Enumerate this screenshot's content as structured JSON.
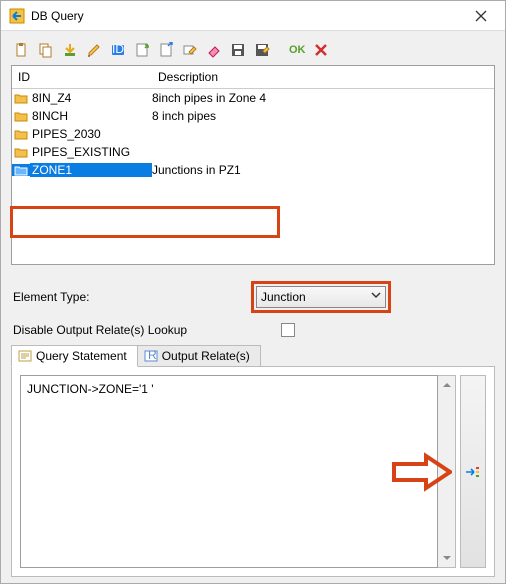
{
  "window": {
    "title": "DB Query"
  },
  "toolbar": {
    "icons": [
      "paste",
      "copy",
      "import",
      "edit-pencil",
      "id-badge",
      "new",
      "open",
      "rename",
      "erase",
      "save",
      "save-as",
      "ok",
      "cancel"
    ],
    "ok_label": "OK"
  },
  "list": {
    "headers": {
      "id": "ID",
      "description": "Description"
    },
    "rows": [
      {
        "id": "8IN_Z4",
        "desc": "8inch pipes in Zone 4",
        "selected": false
      },
      {
        "id": "8INCH",
        "desc": "8 inch pipes",
        "selected": false
      },
      {
        "id": "PIPES_2030",
        "desc": "",
        "selected": false
      },
      {
        "id": "PIPES_EXISTING",
        "desc": "",
        "selected": false
      },
      {
        "id": "ZONE1",
        "desc": "Junctions in PZ1",
        "selected": true
      }
    ]
  },
  "element_type": {
    "label": "Element Type:",
    "value": "Junction"
  },
  "disable_lookup": {
    "label": "Disable Output Relate(s) Lookup",
    "checked": false
  },
  "tabs": {
    "query": "Query Statement",
    "relates": "Output Relate(s)",
    "active": "query"
  },
  "query": {
    "text": "JUNCTION->ZONE='1 '"
  },
  "narrow_icon": "narrow-icon"
}
